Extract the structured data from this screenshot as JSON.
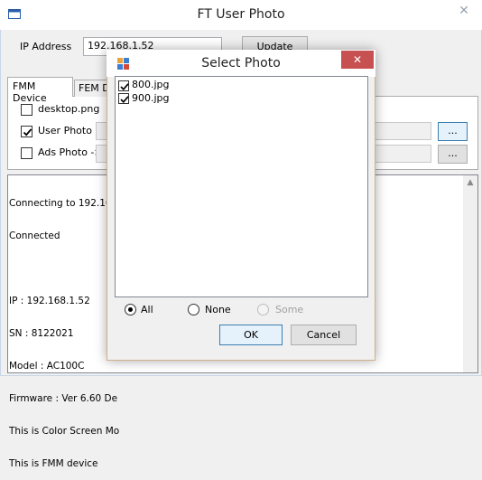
{
  "main": {
    "title": "FT User Photo",
    "close_glyph": "✕",
    "ip_label": "IP Address",
    "ip_value": "192.168.1.52",
    "update_label": "Update",
    "tabs": [
      {
        "label": "FMM Device",
        "selected": true
      },
      {
        "label": "FEM D",
        "selected": false
      }
    ],
    "options": [
      {
        "label": "desktop.png",
        "checked": false
      },
      {
        "label": "User Photo",
        "checked": true
      },
      {
        "label": "Ads Photo ->",
        "checked": false
      }
    ],
    "browse_label": "...",
    "log_lines": [
      "Connecting to 192.168",
      "Connected",
      "",
      "IP : 192.168.1.52",
      "SN : 8122021",
      "Model : AC100C",
      "Firmware : Ver 6.60 De",
      "This is Color Screen Mo",
      "This is FMM device"
    ]
  },
  "dialog": {
    "title": "Select Photo",
    "close_glyph": "✕",
    "files": [
      {
        "name": "800.jpg",
        "checked": true
      },
      {
        "name": "900.jpg",
        "checked": true
      }
    ],
    "radios": [
      {
        "label": "All",
        "selected": true,
        "enabled": true
      },
      {
        "label": "None",
        "selected": false,
        "enabled": true
      },
      {
        "label": "Some",
        "selected": false,
        "enabled": false
      }
    ],
    "ok_label": "OK",
    "cancel_label": "Cancel"
  },
  "colors": {
    "dialog_close_bg": "#c75050",
    "focus_border": "#3c7fb1"
  }
}
